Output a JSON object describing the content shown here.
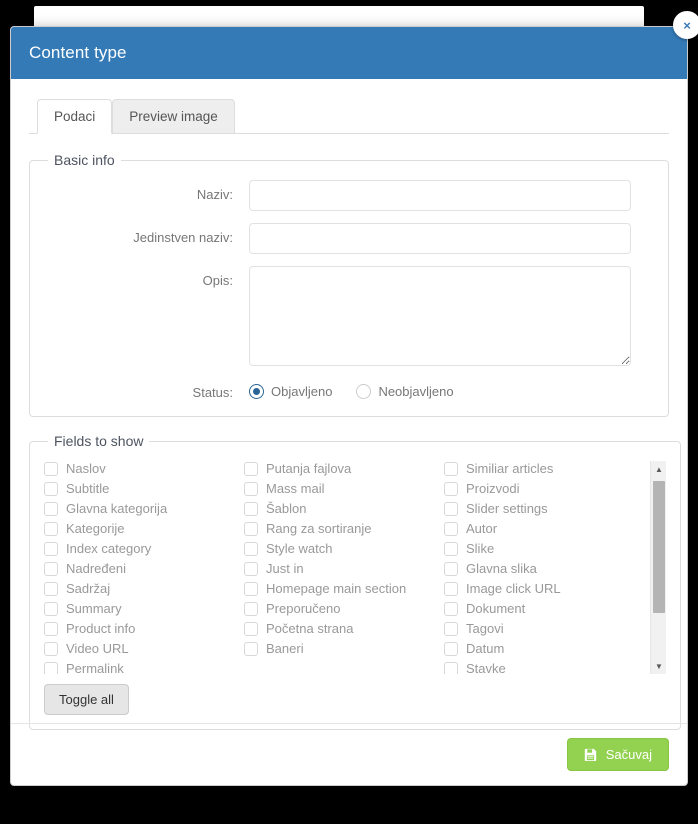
{
  "modal": {
    "title": "Content type",
    "close_label": "×",
    "close_icon": "close-icon"
  },
  "tabs": [
    {
      "label": "Podaci",
      "active": true
    },
    {
      "label": "Preview image",
      "active": false
    }
  ],
  "basic_info": {
    "legend": "Basic info",
    "fields": [
      {
        "label": "Naziv:",
        "value": "",
        "placeholder": "",
        "type": "text"
      },
      {
        "label": "Jedinstven naziv:",
        "value": "",
        "placeholder": "",
        "type": "text"
      },
      {
        "label": "Opis:",
        "value": "",
        "placeholder": "",
        "type": "textarea"
      }
    ],
    "status": {
      "label": "Status:",
      "options": [
        {
          "label": "Objavljeno",
          "checked": true
        },
        {
          "label": "Neobjavljeno",
          "checked": false
        }
      ]
    }
  },
  "fields_to_show": {
    "legend": "Fields to show",
    "columns": [
      [
        "Naslov",
        "Subtitle",
        "Glavna kategorija",
        "Kategorije",
        "Index category",
        "Nadređeni",
        "Sadržaj",
        "Summary",
        "Product info",
        "Video URL",
        "Permalink"
      ],
      [
        "Putanja fajlova",
        "Mass mail",
        "Šablon",
        "Rang za sortiranje",
        "Style watch",
        "Just in",
        "Homepage main section",
        "Preporučeno",
        "Početna strana",
        "Baneri"
      ],
      [
        "Similiar articles",
        "Proizvodi",
        "Slider settings",
        "Autor",
        "Slike",
        "Glavna slika",
        "Image click URL",
        "Dokument",
        "Tagovi",
        "Datum",
        "Stavke"
      ]
    ],
    "scrollbar": {
      "up_arrow": "▲",
      "down_arrow": "▼"
    },
    "toggle_all_label": "Toggle all"
  },
  "footer": {
    "save_label": "Sačuvaj",
    "save_icon": "save-floppy-icon"
  },
  "colors": {
    "header_blue": "#337ab7",
    "save_green": "#93d150",
    "radio_blue": "#2a6496",
    "backdrop": "#000000"
  }
}
